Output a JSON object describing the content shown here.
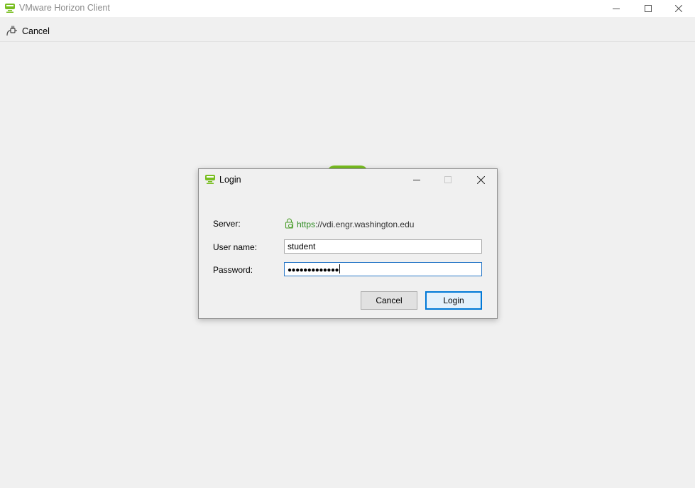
{
  "window": {
    "title": "VMware Horizon Client",
    "icon": "horizon-logo-icon"
  },
  "toolbar": {
    "cancel_label": "Cancel",
    "cancel_icon": "disconnect-plug-icon"
  },
  "dialog": {
    "title": "Login",
    "server_label": "Server:",
    "server_scheme": "https",
    "server_rest": "://vdi.engr.washington.edu",
    "username_label": "User name:",
    "username_value": "student",
    "password_label": "Password:",
    "password_masked": "●●●●●●●●●●●●●",
    "cancel_label": "Cancel",
    "login_label": "Login"
  },
  "colors": {
    "brand_green": "#78be20",
    "https_green": "#2e8b22",
    "focus_blue": "#0078d7"
  }
}
